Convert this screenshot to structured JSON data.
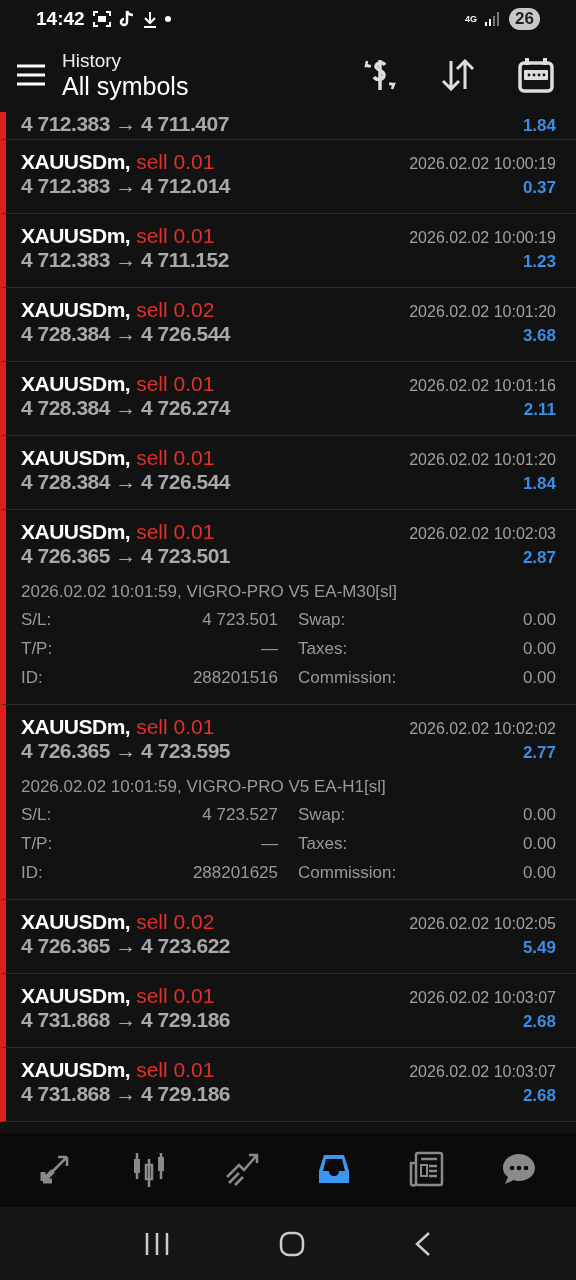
{
  "status_bar": {
    "time": "14:42",
    "network": "4G",
    "battery": "26"
  },
  "header": {
    "title": "History",
    "subtitle": "All symbols"
  },
  "clipped_row": {
    "prices": "4 712.383 → 4 711.407",
    "profit": "1.84"
  },
  "trades": [
    {
      "symbol": "XAUUSDm,",
      "side": "sell",
      "volume": "0.01",
      "time": "2026.02.02 10:00:19",
      "prices": "4 712.383 → 4 712.014",
      "profit": "0.37",
      "expanded": false
    },
    {
      "symbol": "XAUUSDm,",
      "side": "sell",
      "volume": "0.01",
      "time": "2026.02.02 10:00:19",
      "prices": "4 712.383 → 4 711.152",
      "profit": "1.23",
      "expanded": false
    },
    {
      "symbol": "XAUUSDm,",
      "side": "sell",
      "volume": "0.02",
      "time": "2026.02.02 10:01:20",
      "prices": "4 728.384 → 4 726.544",
      "profit": "3.68",
      "expanded": false
    },
    {
      "symbol": "XAUUSDm,",
      "side": "sell",
      "volume": "0.01",
      "time": "2026.02.02 10:01:16",
      "prices": "4 728.384 → 4 726.274",
      "profit": "2.11",
      "expanded": false
    },
    {
      "symbol": "XAUUSDm,",
      "side": "sell",
      "volume": "0.01",
      "time": "2026.02.02 10:01:20",
      "prices": "4 728.384 → 4 726.544",
      "profit": "1.84",
      "expanded": false
    },
    {
      "symbol": "XAUUSDm,",
      "side": "sell",
      "volume": "0.01",
      "time": "2026.02.02 10:02:03",
      "prices": "4 726.365 → 4 723.501",
      "profit": "2.87",
      "expanded": true,
      "comment": "2026.02.02 10:01:59, VIGRO-PRO V5 EA-M30[sl]",
      "details": [
        [
          "S/L:",
          "4 723.501",
          "Swap:",
          "0.00"
        ],
        [
          "T/P:",
          "—",
          "Taxes:",
          "0.00"
        ],
        [
          "ID:",
          "288201516",
          "Commission:",
          "0.00"
        ]
      ]
    },
    {
      "symbol": "XAUUSDm,",
      "side": "sell",
      "volume": "0.01",
      "time": "2026.02.02 10:02:02",
      "prices": "4 726.365 → 4 723.595",
      "profit": "2.77",
      "expanded": true,
      "comment": "2026.02.02 10:01:59, VIGRO-PRO V5 EA-H1[sl]",
      "details": [
        [
          "S/L:",
          "4 723.527",
          "Swap:",
          "0.00"
        ],
        [
          "T/P:",
          "—",
          "Taxes:",
          "0.00"
        ],
        [
          "ID:",
          "288201625",
          "Commission:",
          "0.00"
        ]
      ]
    },
    {
      "symbol": "XAUUSDm,",
      "side": "sell",
      "volume": "0.02",
      "time": "2026.02.02 10:02:05",
      "prices": "4 726.365 → 4 723.622",
      "profit": "5.49",
      "expanded": false
    },
    {
      "symbol": "XAUUSDm,",
      "side": "sell",
      "volume": "0.01",
      "time": "2026.02.02 10:03:07",
      "prices": "4 731.868 → 4 729.186",
      "profit": "2.68",
      "expanded": false
    },
    {
      "symbol": "XAUUSDm,",
      "side": "sell",
      "volume": "0.01",
      "time": "2026.02.02 10:03:07",
      "prices": "4 731.868 → 4 729.186",
      "profit": "2.68",
      "expanded": false
    }
  ],
  "bottom_nav": [
    {
      "kind": "quotes",
      "selected": false
    },
    {
      "kind": "chart",
      "selected": false
    },
    {
      "kind": "trade",
      "selected": false
    },
    {
      "kind": "history",
      "selected": true
    },
    {
      "kind": "news",
      "selected": false
    },
    {
      "kind": "chat",
      "selected": false
    }
  ]
}
